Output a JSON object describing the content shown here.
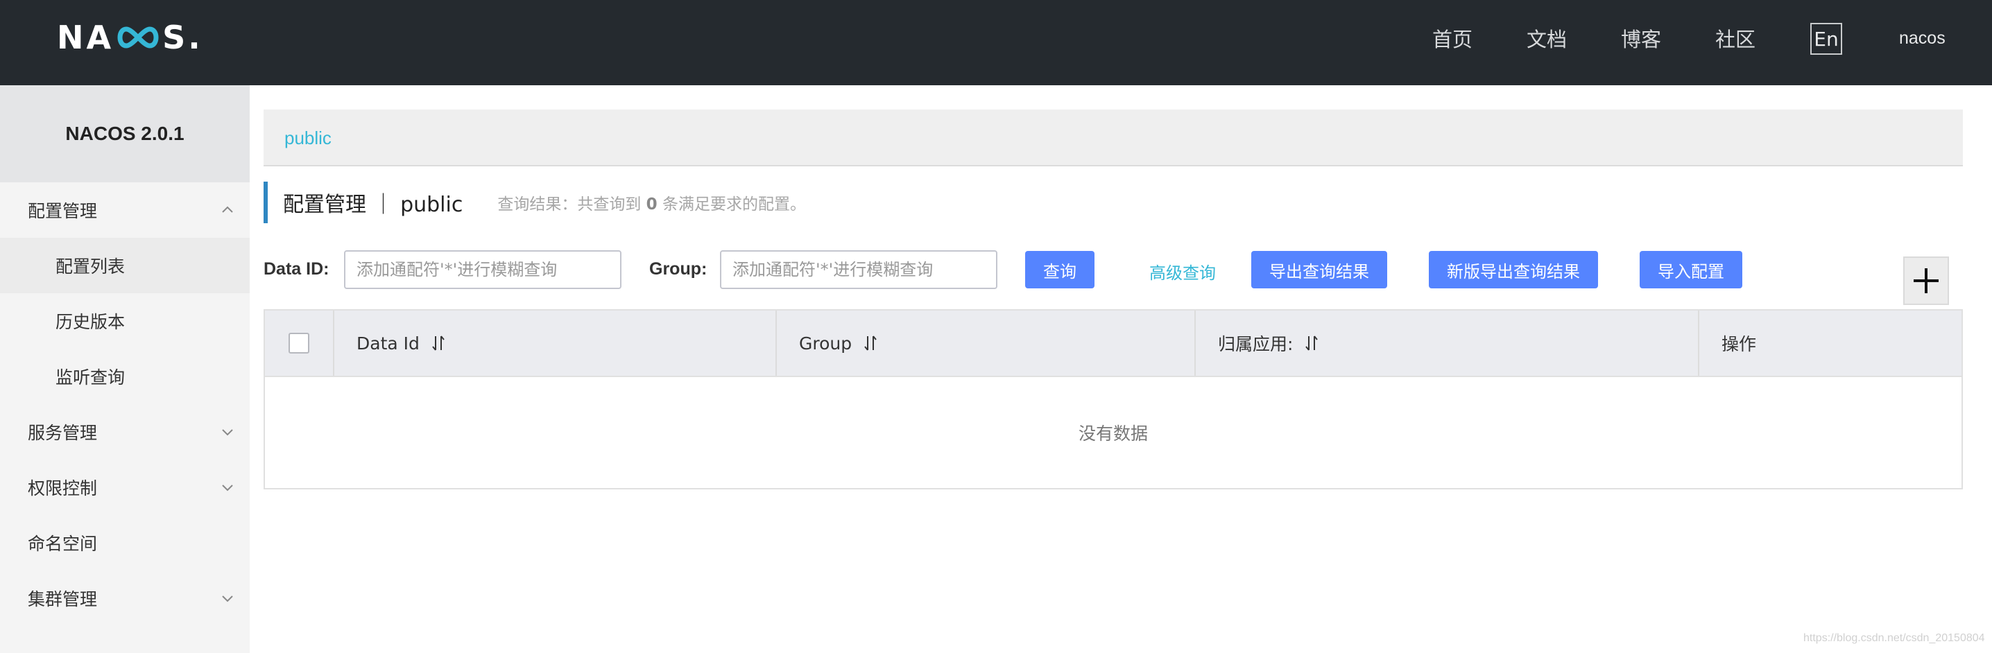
{
  "header": {
    "logo_text_prefix": "NA",
    "logo_text_suffix": "S.",
    "nav": [
      "首页",
      "文档",
      "博客",
      "社区"
    ],
    "lang_button": "En",
    "username": "nacos"
  },
  "sidebar": {
    "version": "NACOS 2.0.1",
    "items": [
      {
        "label": "配置管理",
        "expanded": true
      },
      {
        "label": "配置列表",
        "active": true
      },
      {
        "label": "历史版本"
      },
      {
        "label": "监听查询"
      },
      {
        "label": "服务管理",
        "expanded": false
      },
      {
        "label": "权限控制",
        "expanded": false
      },
      {
        "label": "命名空间"
      },
      {
        "label": "集群管理",
        "expanded": false
      }
    ]
  },
  "breadcrumb": {
    "namespace": "public"
  },
  "page": {
    "title": "配置管理 ｜ public",
    "result_prefix": "查询结果：共查询到",
    "result_count": "0",
    "result_suffix": "条满足要求的配置。"
  },
  "search": {
    "data_id_label": "Data ID:",
    "data_id_placeholder": "添加通配符'*'进行模糊查询",
    "data_id_value": "",
    "group_label": "Group:",
    "group_placeholder": "添加通配符'*'进行模糊查询",
    "group_value": "",
    "query_button": "查询",
    "advanced_query": "高级查询",
    "export_button": "导出查询结果",
    "export_new_button": "新版导出查询结果",
    "import_button": "导入配置"
  },
  "table": {
    "columns": [
      "Data Id",
      "Group",
      "归属应用:",
      "操作"
    ],
    "empty_text": "没有数据"
  },
  "watermark": "https://blog.csdn.net/csdn_20150804",
  "colors": {
    "header_bg": "#252a2f",
    "accent": "#35b7d6",
    "primary_button": "#5584ff",
    "title_bar": "#2f87c2"
  }
}
